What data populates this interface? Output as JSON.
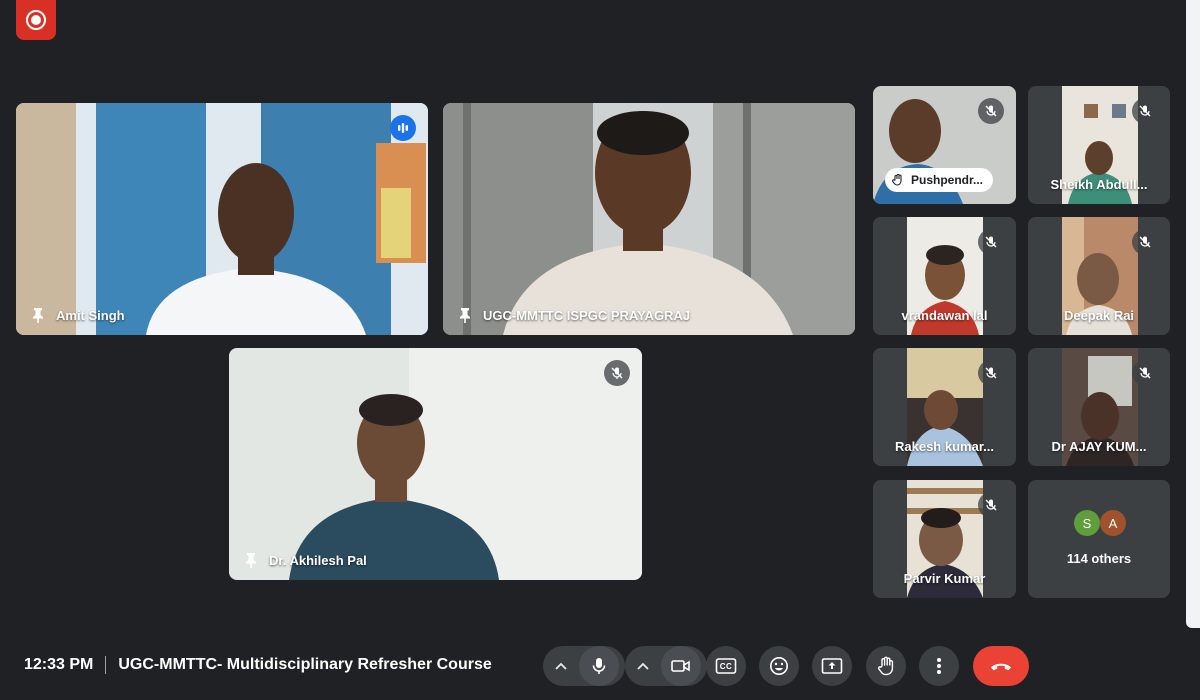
{
  "meeting": {
    "time": "12:33 PM",
    "title": "UGC-MMTTC- Multidisciplinary Refresher Course"
  },
  "main_tiles": [
    {
      "name": "Amit Singh",
      "status": "speaking"
    },
    {
      "name": "UGC-MMTTC ISPGC PRAYAGRAJ",
      "status": "unmuted"
    },
    {
      "name": "Dr. Akhilesh Pal",
      "status": "muted"
    }
  ],
  "side_tiles": [
    {
      "name": "Pushpendr...",
      "status": "muted",
      "hand_raised": true
    },
    {
      "name": "Sheikh Abdull...",
      "status": "muted"
    },
    {
      "name": "vrandawan lal",
      "status": "muted"
    },
    {
      "name": "Deepak Rai",
      "status": "muted"
    },
    {
      "name": "Rakesh kumar...",
      "status": "muted"
    },
    {
      "name": "Dr AJAY KUM...",
      "status": "muted"
    },
    {
      "name": "Parvir Kumar",
      "status": "muted"
    }
  ],
  "others": {
    "avatars": [
      {
        "letter": "S",
        "color": "#5f9e3a"
      },
      {
        "letter": "A",
        "color": "#a0522d"
      }
    ],
    "count_label": "114 others"
  },
  "controls": {
    "cc_label": "CC",
    "items": [
      "mic",
      "camera",
      "captions",
      "reactions",
      "present",
      "raise-hand",
      "more-options",
      "leave-call"
    ]
  },
  "colors": {
    "background": "#202124",
    "tile": "#3c4043",
    "accent": "#8ab4f8",
    "speaking": "#1a73e8",
    "record": "#d93025",
    "end_call": "#ea4335"
  }
}
